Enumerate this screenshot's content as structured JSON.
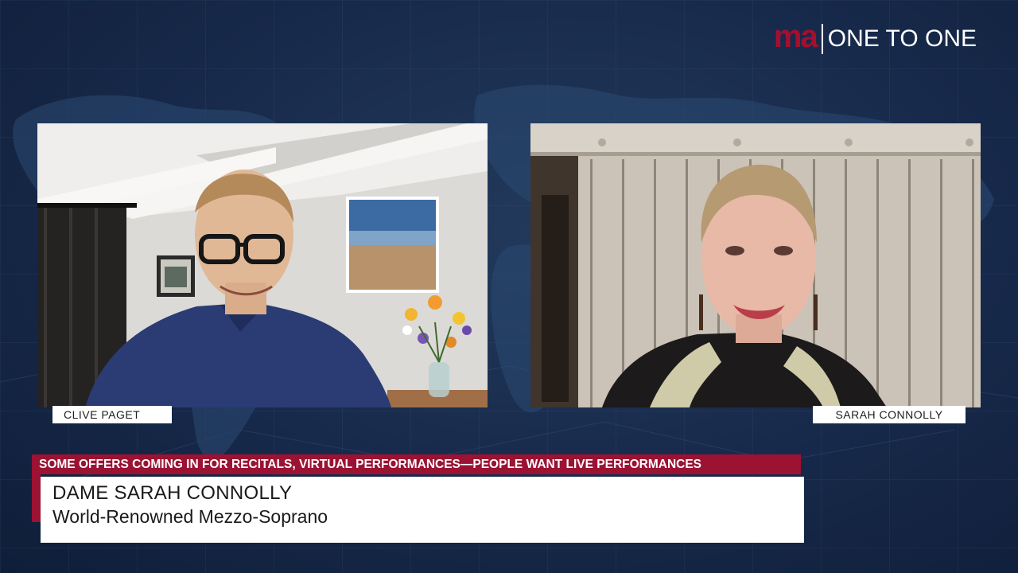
{
  "brand": {
    "logo": "ma",
    "title": "ONE TO ONE",
    "logo_color": "#a3102f"
  },
  "participants": [
    {
      "name": "CLIVE PAGET"
    },
    {
      "name": "SARAH CONNOLLY"
    }
  ],
  "ticker": {
    "text": "SOME OFFERS COMING IN FOR RECITALS, VIRTUAL PERFORMANCES—PEOPLE WANT LIVE PERFORMANCES",
    "color": "#9c1232"
  },
  "lower_third": {
    "name": "DAME SARAH CONNOLLY",
    "title": "World-Renowned Mezzo-Soprano"
  },
  "colors": {
    "background": "#17294a",
    "accent": "#9c1232"
  }
}
